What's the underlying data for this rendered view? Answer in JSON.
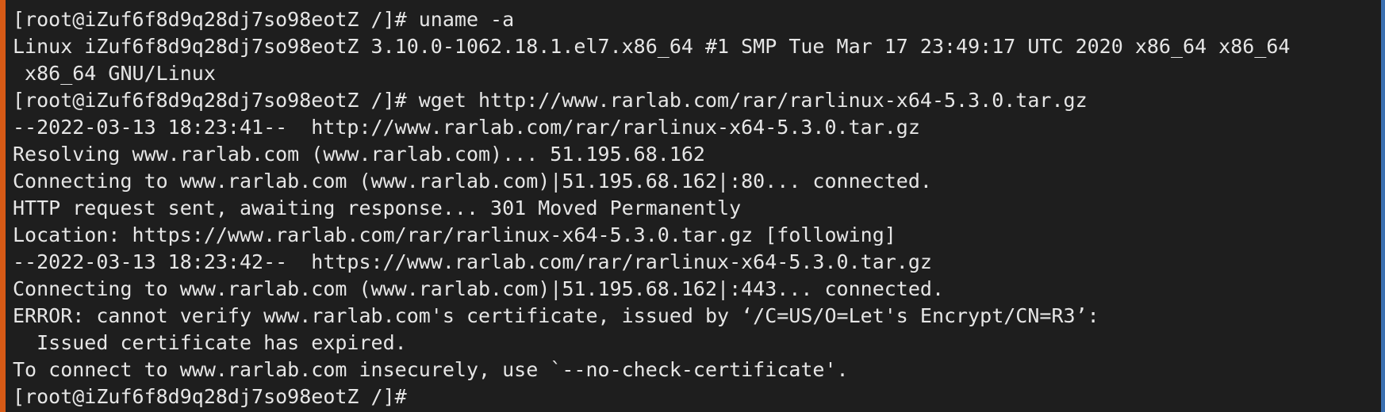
{
  "terminal": {
    "lines": [
      "[root@iZuf6f8d9q28dj7so98eotZ /]# uname -a",
      "Linux iZuf6f8d9q28dj7so98eotZ 3.10.0-1062.18.1.el7.x86_64 #1 SMP Tue Mar 17 23:49:17 UTC 2020 x86_64 x86_64",
      " x86_64 GNU/Linux",
      "[root@iZuf6f8d9q28dj7so98eotZ /]# wget http://www.rarlab.com/rar/rarlinux-x64-5.3.0.tar.gz",
      "--2022-03-13 18:23:41--  http://www.rarlab.com/rar/rarlinux-x64-5.3.0.tar.gz",
      "Resolving www.rarlab.com (www.rarlab.com)... 51.195.68.162",
      "Connecting to www.rarlab.com (www.rarlab.com)|51.195.68.162|:80... connected.",
      "HTTP request sent, awaiting response... 301 Moved Permanently",
      "Location: https://www.rarlab.com/rar/rarlinux-x64-5.3.0.tar.gz [following]",
      "--2022-03-13 18:23:42--  https://www.rarlab.com/rar/rarlinux-x64-5.3.0.tar.gz",
      "Connecting to www.rarlab.com (www.rarlab.com)|51.195.68.162|:443... connected.",
      "ERROR: cannot verify www.rarlab.com's certificate, issued by ‘/C=US/O=Let's Encrypt/CN=R3’:",
      "  Issued certificate has expired.",
      "To connect to www.rarlab.com insecurely, use `--no-check-certificate'.",
      "[root@iZuf6f8d9q28dj7so98eotZ /]#"
    ]
  },
  "colors": {
    "background": "#1e1e1e",
    "foreground": "#e6e6e6",
    "left_accent": "#d65a16",
    "right_accent": "#3a6fb0"
  }
}
